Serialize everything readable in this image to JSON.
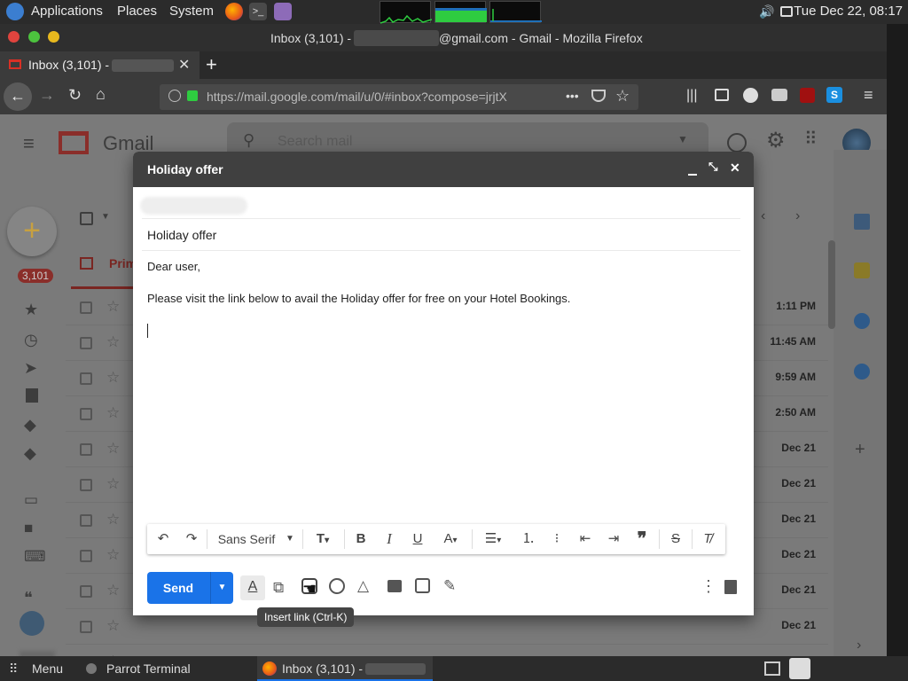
{
  "top_panel": {
    "applications": "Applications",
    "places": "Places",
    "system": "System",
    "clock": "Tue Dec 22, 08:17"
  },
  "window": {
    "title_prefix": "Inbox (3,101) -",
    "title_suffix": "@gmail.com - Gmail - Mozilla Firefox"
  },
  "tab": {
    "label": "Inbox (3,101) -",
    "new_tab": "+"
  },
  "url": {
    "text": "https://mail.google.com/mail/u/0/#inbox?compose=jrjtX",
    "dots": "•••"
  },
  "gmail": {
    "logo_text": "Gmail",
    "search_placeholder": "Search mail",
    "unread_badge": "3,101",
    "primary_tab": "Prim",
    "rows": [
      {
        "date": "1:11 PM"
      },
      {
        "date": "11:45 AM"
      },
      {
        "date": "9:59 AM"
      },
      {
        "date": "2:50 AM"
      },
      {
        "date": "Dec 21"
      },
      {
        "date": "Dec 21"
      },
      {
        "date": "Dec 21"
      },
      {
        "date": "Dec 21"
      },
      {
        "date": "Dec 21"
      },
      {
        "date": "Dec 21"
      },
      {
        "date": "Dec 21"
      }
    ]
  },
  "compose": {
    "title": "Holiday offer",
    "subject": "Holiday offer",
    "body_line1": "Dear user,",
    "body_line2": "Please visit the link below to avail the Holiday offer for free on your Hotel Bookings.",
    "font": "Sans Serif",
    "send": "Send",
    "tooltip": "Insert link (Ctrl-K)"
  },
  "taskbar": {
    "menu": "Menu",
    "terminal": "Parrot Terminal",
    "firefox": "Inbox (3,101) -"
  }
}
